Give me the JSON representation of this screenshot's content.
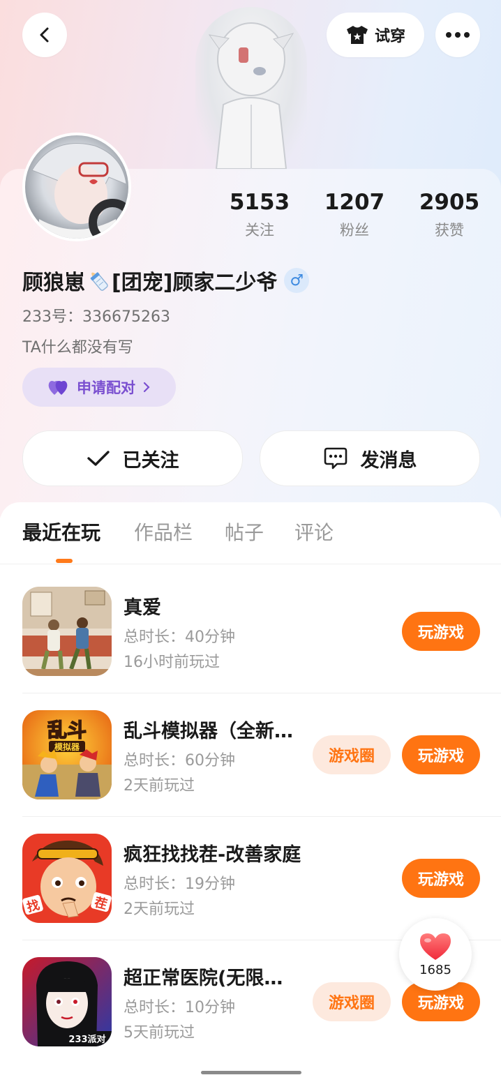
{
  "header": {
    "tryon_label": "试穿"
  },
  "stats": [
    {
      "num": "5153",
      "label": "关注"
    },
    {
      "num": "1207",
      "label": "粉丝"
    },
    {
      "num": "2905",
      "label": "获赞"
    }
  ],
  "profile": {
    "name_part1": "顾狼崽",
    "name_part2": "[团宠]顾家二少爷",
    "gender_symbol": "♂",
    "uid": "233号：336675263",
    "bio": "TA什么都没有写",
    "pair_label": "申请配对"
  },
  "actions": {
    "follow_label": "已关注",
    "message_label": "发消息"
  },
  "tabs": [
    "最近在玩",
    "作品栏",
    "帖子",
    "评论"
  ],
  "games": [
    {
      "title": "真爱",
      "time": "总时长：40分钟",
      "last": "16小时前玩过",
      "has_circle": false
    },
    {
      "title": "乱斗模拟器（全新…",
      "time": "总时长：60分钟",
      "last": "2天前玩过",
      "has_circle": true,
      "icon_text": "乱斗",
      "icon_sub": "模拟器"
    },
    {
      "title": "疯狂找找茬-改善家庭",
      "time": "总时长：19分钟",
      "last": "2天前玩过",
      "has_circle": false,
      "icon_left": "找",
      "icon_right": "茬"
    },
    {
      "title": "超正常医院(无限…",
      "time": "总时长：10分钟",
      "last": "5天前玩过",
      "has_circle": true,
      "icon_badge": "233派对"
    }
  ],
  "buttons": {
    "play": "玩游戏",
    "circle": "游戏圈"
  },
  "like": {
    "count": "1685"
  },
  "colors": {
    "accent": "#ff7412",
    "pair": "#7a4fd0",
    "gender": "#3d8ae0"
  }
}
